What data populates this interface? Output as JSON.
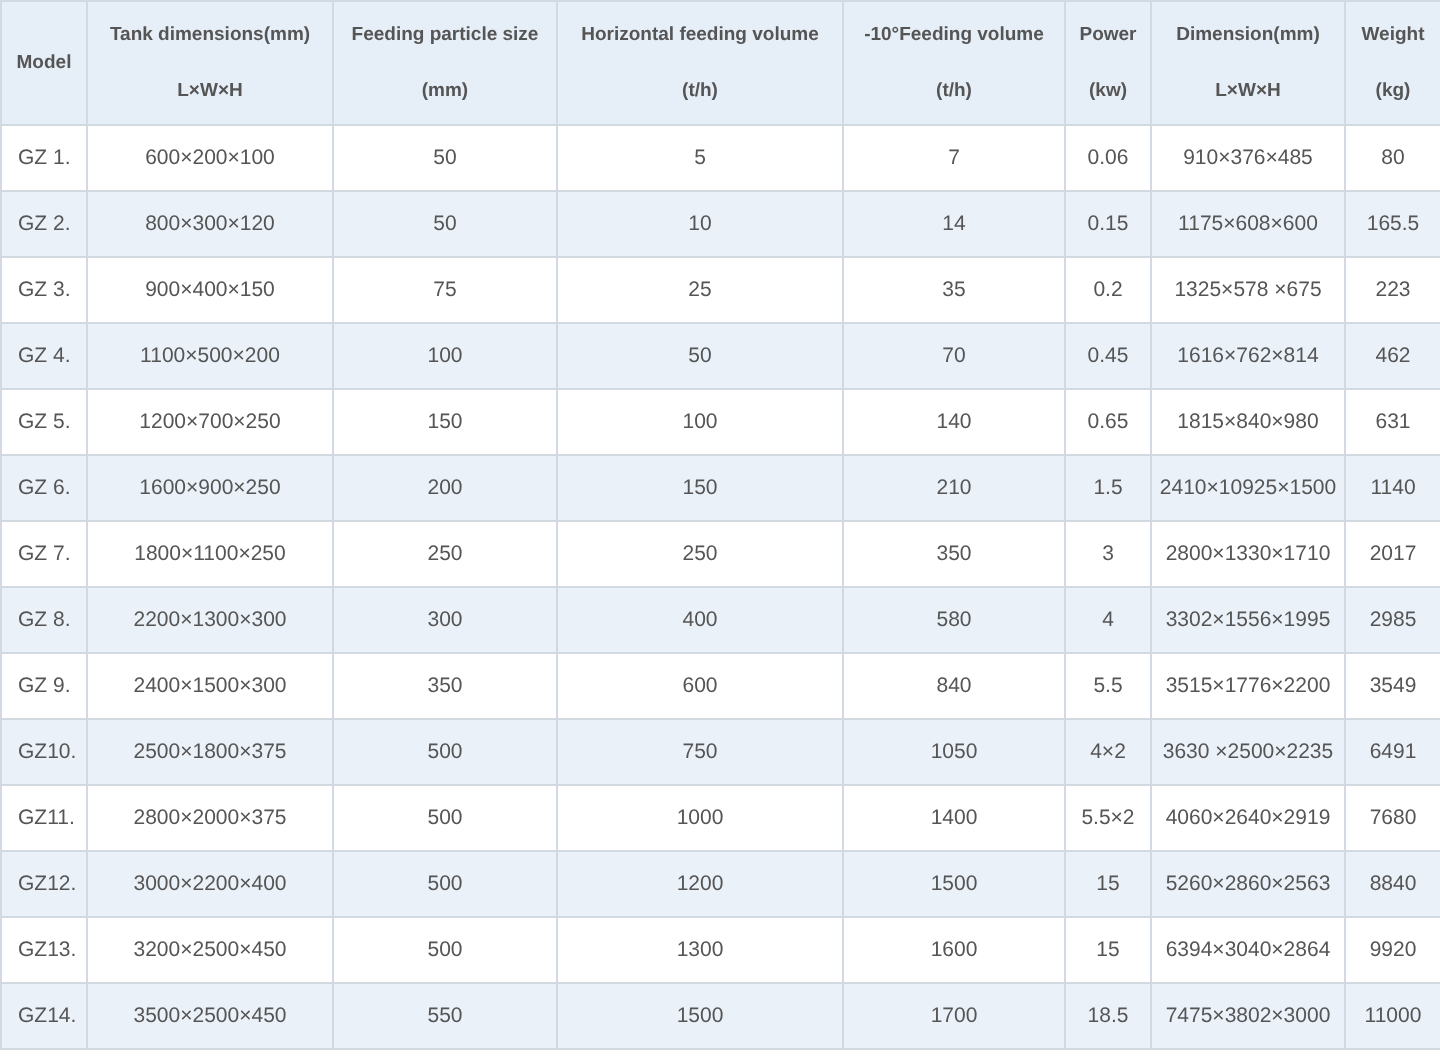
{
  "table": {
    "columns": [
      {
        "lines": [
          "Model"
        ]
      },
      {
        "lines": [
          "Tank dimensions(mm)",
          "L×W×H"
        ]
      },
      {
        "lines": [
          "Feeding particle size",
          "(mm)"
        ]
      },
      {
        "lines": [
          "Horizontal feeding volume",
          "(t/h)"
        ]
      },
      {
        "lines": [
          "-10°Feeding volume",
          "(t/h)"
        ]
      },
      {
        "lines": [
          "Power",
          "(kw)"
        ]
      },
      {
        "lines": [
          "Dimension(mm)",
          "L×W×H"
        ]
      },
      {
        "lines": [
          "Weight",
          "(kg)"
        ]
      }
    ],
    "rows": [
      [
        "GZ 1.",
        "600×200×100",
        "50",
        "5",
        "7",
        "0.06",
        "910×376×485",
        "80"
      ],
      [
        "GZ 2.",
        "800×300×120",
        "50",
        "10",
        "14",
        "0.15",
        "1175×608×600",
        "165.5"
      ],
      [
        "GZ 3.",
        "900×400×150",
        "75",
        "25",
        "35",
        "0.2",
        "1325×578 ×675",
        "223"
      ],
      [
        "GZ 4.",
        "1100×500×200",
        "100",
        "50",
        "70",
        "0.45",
        "1616×762×814",
        "462"
      ],
      [
        "GZ 5.",
        "1200×700×250",
        "150",
        "100",
        "140",
        "0.65",
        "1815×840×980",
        "631"
      ],
      [
        "GZ 6.",
        "1600×900×250",
        "200",
        "150",
        "210",
        "1.5",
        "2410×10925×1500",
        "1140"
      ],
      [
        "GZ 7.",
        "1800×1100×250",
        "250",
        "250",
        "350",
        "3",
        "2800×1330×1710",
        "2017"
      ],
      [
        "GZ 8.",
        "2200×1300×300",
        "300",
        "400",
        "580",
        "4",
        "3302×1556×1995",
        "2985"
      ],
      [
        "GZ 9.",
        "2400×1500×300",
        "350",
        "600",
        "840",
        "5.5",
        "3515×1776×2200",
        "3549"
      ],
      [
        "GZ10.",
        "2500×1800×375",
        "500",
        "750",
        "1050",
        "4×2",
        "3630 ×2500×2235",
        "6491"
      ],
      [
        "GZ11.",
        "2800×2000×375",
        "500",
        "1000",
        "1400",
        "5.5×2",
        "4060×2640×2919",
        "7680"
      ],
      [
        "GZ12.",
        "3000×2200×400",
        "500",
        "1200",
        "1500",
        "15",
        "5260×2860×2563",
        "8840"
      ],
      [
        "GZ13.",
        "3200×2500×450",
        "500",
        "1300",
        "1600",
        "15",
        "6394×3040×2864",
        "9920"
      ],
      [
        "GZ14.",
        "3500×2500×450",
        "550",
        "1500",
        "1700",
        "18.5",
        "7475×3802×3000",
        "11000"
      ]
    ]
  }
}
